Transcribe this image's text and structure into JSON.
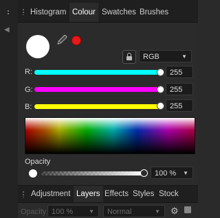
{
  "tabs_top": [
    "Histogram",
    "Colour",
    "Swatches",
    "Brushes"
  ],
  "active_top_tab": "Colour",
  "colors": {
    "primary_fill": "#ffffff",
    "secondary_fill": "#e41b1b",
    "red_track": "#00ffff",
    "green_track": "#ff00ff",
    "blue_track": "#ffff00"
  },
  "color_model": {
    "value": "RGB"
  },
  "channels": [
    {
      "label": "R:",
      "value": "255"
    },
    {
      "label": "G:",
      "value": "255"
    },
    {
      "label": "B:",
      "value": "255"
    }
  ],
  "opacity": {
    "label": "Opacity",
    "value": "100 %"
  },
  "tabs_bottom": [
    "Adjustment",
    "Layers",
    "Effects",
    "Styles",
    "Stock"
  ],
  "active_bottom_tab": "Layers",
  "layers_bar": {
    "opacity_label": "Opacity",
    "opacity_value": "100 %",
    "blend_mode": "Normal"
  }
}
